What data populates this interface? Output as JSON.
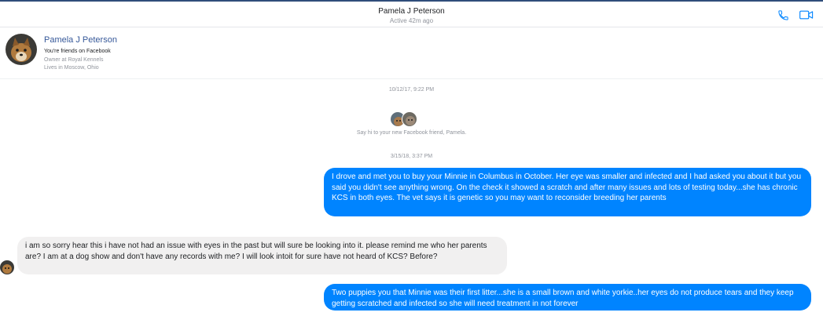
{
  "header": {
    "name": "Pamela J Peterson",
    "status": "Active 42m ago",
    "accent_color": "#0084ff"
  },
  "profile": {
    "name": "Pamela J Peterson",
    "friends_text": "You're friends on Facebook",
    "work": "Owner at Royal Kennels",
    "lives": "Lives in Moscow, Ohio"
  },
  "conversation": {
    "timestamp_1": "10/12/17, 9:22 PM",
    "intro_text": "Say hi to your new Facebook friend, Pamela.",
    "timestamp_2": "3/15/18, 3:37 PM",
    "messages": [
      {
        "direction": "outgoing",
        "text": "I drove and met you to buy your Minnie in Columbus in October. Her eye was smaller and infected and I had asked you about it but you said you didn't see anything wrong. On the check it showed a scratch and after many issues and lots of testing today...she has chronic KCS in both eyes. The vet says it is genetic so you may want to reconsider breeding her parents"
      },
      {
        "direction": "incoming",
        "text": "i am so sorry hear this i have not had an issue with eyes in the past but will sure be looking into it. please remind me who her parents are? I am at a dog show and don't have any records with me? I will look intoit for sure have not heard of KCS? Before?"
      },
      {
        "direction": "outgoing",
        "text": "Two puppies you that Minnie was their first litter...she is a small brown and white yorkie..her eyes do not produce tears and they keep getting scratched and infected so she will need treatment in not forever"
      }
    ]
  },
  "icons": {
    "call": "phone-icon",
    "video": "video-camera-icon"
  }
}
